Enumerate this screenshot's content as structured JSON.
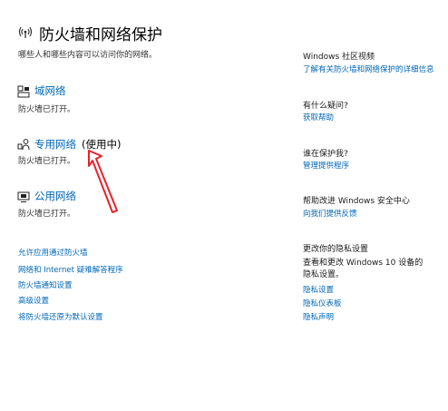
{
  "page": {
    "title": "防火墙和网络保护",
    "subtitle": "哪些人和哪些内容可以访问你的网络。"
  },
  "networks": [
    {
      "name": "域网络",
      "active_label": "",
      "status": "防火墙已打开。",
      "icon": "domain-network-icon"
    },
    {
      "name": "专用网络",
      "active_label": "(使用中)",
      "status": "防火墙已打开。",
      "icon": "private-network-icon"
    },
    {
      "name": "公用网络",
      "active_label": "",
      "status": "防火墙已打开。",
      "icon": "public-network-icon"
    }
  ],
  "links": [
    "允许应用通过防火墙",
    "网络和 Internet 疑难解答程序",
    "防火墙通知设置",
    "高级设置",
    "将防火墙还原为默认设置"
  ],
  "sidebar": {
    "community": {
      "heading": "Windows 社区视频",
      "link": "了解有关防火墙和网络保护的详细信息"
    },
    "question": {
      "heading": "有什么疑问?",
      "link": "获取帮助"
    },
    "protecting": {
      "heading": "谁在保护我?",
      "link": "管理提供程序"
    },
    "improve": {
      "heading": "帮助改进 Windows 安全中心",
      "link": "向我们提供反馈"
    },
    "privacy": {
      "heading": "更改你的隐私设置",
      "text": "查看和更改 Windows 10 设备的隐私设置。",
      "links": [
        "隐私设置",
        "隐私仪表板",
        "隐私声明"
      ]
    }
  },
  "colors": {
    "link": "#0067b8",
    "arrow": "#e8222a",
    "text": "#1a1a1a"
  }
}
